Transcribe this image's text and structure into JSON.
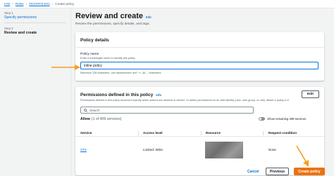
{
  "breadcrumb": [
    "IAM",
    "Roles",
    "TESTROLE01",
    "Create policy"
  ],
  "steps": {
    "step1_num": "Step 1",
    "step1_label": "Specify permissions",
    "step2_num": "Step 2",
    "step2_label": "Review and create"
  },
  "header": {
    "title": "Review and create",
    "info": "Info",
    "subtitle": "Review the permissions, specify details, and tags."
  },
  "policy_details": {
    "heading": "Policy details",
    "name_label": "Policy name",
    "name_desc": "Enter a meaningful name to identify this policy.",
    "name_value": "inline policy",
    "name_hint": "Maximum 128 characters. Use alphanumeric and '+=,.@-_' characters."
  },
  "permissions": {
    "heading": "Permissions defined in this policy",
    "info": "Info",
    "edit_label": "Edit",
    "description": "Permissions defined in this policy document specify which actions are allowed or denied. To define permissions for an IAM identity (user, user group, or role), attach a policy to it.",
    "search_placeholder": "Search",
    "allow_label": "Allow",
    "allow_count": "(1 of 409 services)",
    "toggle_label": "Show remaining 408 services",
    "columns": [
      "Service",
      "Access level",
      "Resource",
      "Request condition"
    ],
    "rows": [
      {
        "service": "STS",
        "access": "Limited: Write",
        "resource": "",
        "condition": "None"
      }
    ]
  },
  "footer": {
    "cancel": "Cancel",
    "previous": "Previous",
    "create": "Create policy"
  },
  "colors": {
    "accent": "#0972d3",
    "primary_button": "#ec7211",
    "annotation_arrow": "#f4a020"
  }
}
